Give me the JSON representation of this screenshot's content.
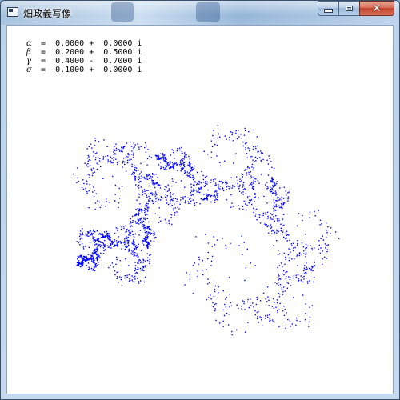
{
  "window": {
    "title": "畑政義写像",
    "close_symbol": "✕"
  },
  "parameters": [
    {
      "symbol": "α",
      "text": " =  0.0000 +  0.0000 i"
    },
    {
      "symbol": "β",
      "text": " =  0.2000 +  0.5000 i"
    },
    {
      "symbol": "γ",
      "text": " =  0.4000 -  0.7000 i"
    },
    {
      "symbol": "σ",
      "text": " =  0.1000 +  0.0000 i"
    }
  ],
  "fractal": {
    "color": "#0000ff",
    "alpha": [
      0.0,
      0.0
    ],
    "beta": [
      0.2,
      0.5
    ],
    "gamma": [
      0.4,
      -0.7
    ],
    "sigma": [
      0.1,
      0.0
    ]
  },
  "colors": {
    "titlebar": "#a4c1e0",
    "client_background": "#ffffff",
    "close_button": "#c4412a"
  }
}
